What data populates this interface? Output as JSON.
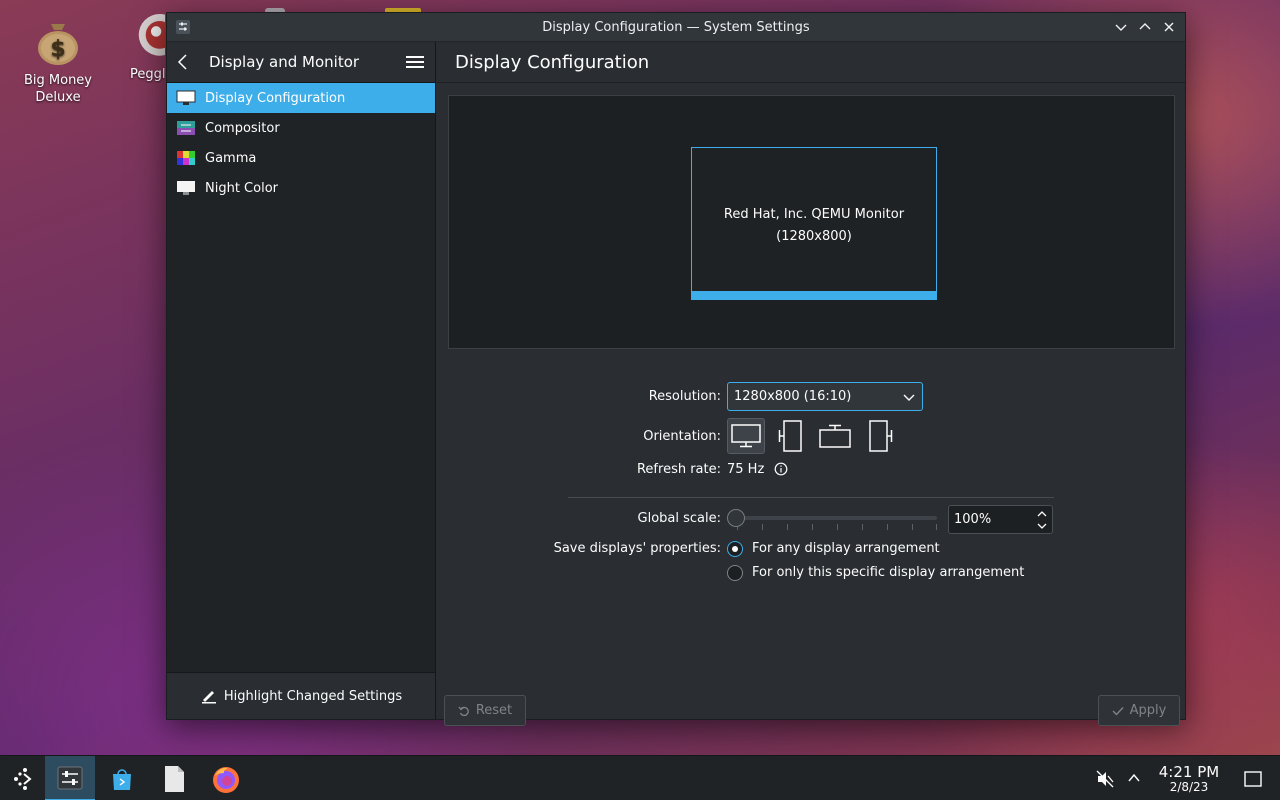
{
  "desktop": {
    "icons": [
      {
        "label": "Big Money\nDeluxe"
      },
      {
        "label": "Peggle"
      }
    ]
  },
  "window": {
    "title": "Display Configuration — System Settings"
  },
  "sidebar": {
    "header": "Display and Monitor",
    "items": [
      {
        "label": "Display Configuration",
        "icon": "monitor-icon"
      },
      {
        "label": "Compositor",
        "icon": "compositor-icon"
      },
      {
        "label": "Gamma",
        "icon": "gamma-icon"
      },
      {
        "label": "Night Color",
        "icon": "night-color-icon"
      }
    ],
    "footer": "Highlight Changed Settings"
  },
  "main": {
    "title": "Display Configuration",
    "monitor_name": "Red Hat, Inc. QEMU Monitor",
    "monitor_resolution": "(1280x800)",
    "resolution_label": "Resolution:",
    "resolution_value": "1280x800 (16:10)",
    "orientation_label": "Orientation:",
    "refresh_label": "Refresh rate:",
    "refresh_value": "75 Hz",
    "scale_label": "Global scale:",
    "scale_value": "100%",
    "save_label": "Save displays' properties:",
    "radio_any": "For any display arrangement",
    "radio_specific": "For only this specific display arrangement",
    "reset_label": "Reset",
    "apply_label": "Apply"
  },
  "taskbar": {
    "time": "4:21 PM",
    "date": "2/8/23"
  },
  "colors": {
    "accent": "#3daee9",
    "window_bg": "#2a2e32",
    "sidebar_bg": "#202326"
  }
}
